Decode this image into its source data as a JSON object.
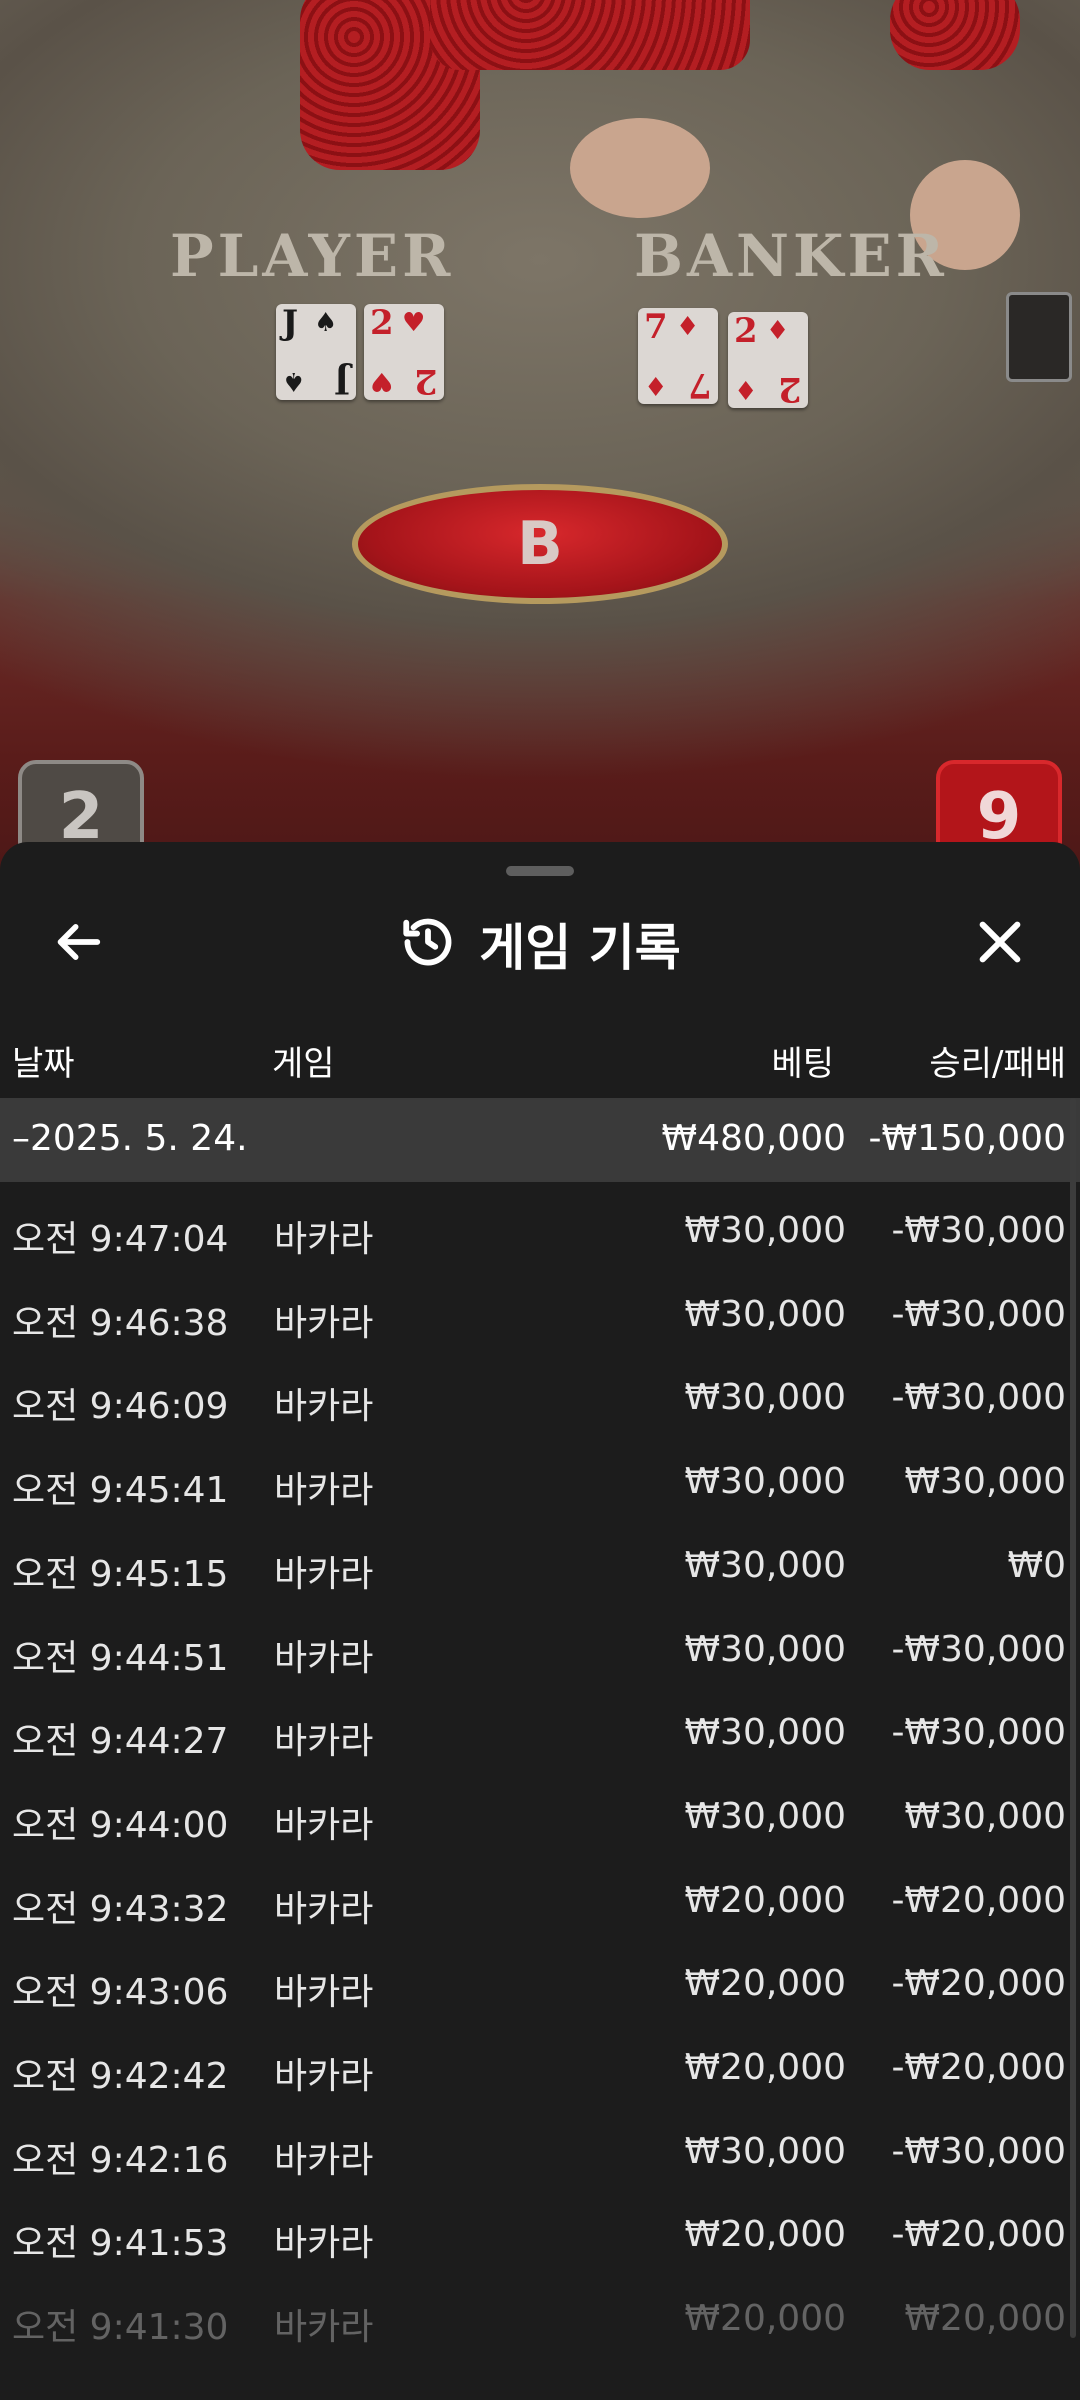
{
  "table": {
    "player_label": "PLAYER",
    "banker_label": "BANKER",
    "player_cards": [
      {
        "rank": "J",
        "suit": "♠",
        "color": "#1a1a1a"
      },
      {
        "rank": "2",
        "suit": "♥",
        "color": "#c4202a"
      }
    ],
    "banker_cards": [
      {
        "rank": "7",
        "suit": "♦",
        "color": "#c4202a"
      },
      {
        "rank": "2",
        "suit": "♦",
        "color": "#c4202a"
      }
    ],
    "result_letter": "B",
    "player_score": "2",
    "banker_score": "9"
  },
  "sheet": {
    "title": "게임 기록",
    "icons": {
      "back": "arrow-left-icon",
      "history": "history-icon",
      "close": "close-icon"
    },
    "columns": {
      "date": "날짜",
      "game": "게임",
      "bet": "베팅",
      "win_loss": "승리/패배"
    },
    "day_summary": {
      "date": "–2025. 5. 24.",
      "bet": "₩480,000",
      "win_loss": "-₩150,000"
    },
    "rows": [
      {
        "time": "오전 9:47:04",
        "game": "바카라",
        "bet": "₩30,000",
        "result": "-₩30,000"
      },
      {
        "time": "오전 9:46:38",
        "game": "바카라",
        "bet": "₩30,000",
        "result": "-₩30,000"
      },
      {
        "time": "오전 9:46:09",
        "game": "바카라",
        "bet": "₩30,000",
        "result": "-₩30,000"
      },
      {
        "time": "오전 9:45:41",
        "game": "바카라",
        "bet": "₩30,000",
        "result": "₩30,000"
      },
      {
        "time": "오전 9:45:15",
        "game": "바카라",
        "bet": "₩30,000",
        "result": "₩0"
      },
      {
        "time": "오전 9:44:51",
        "game": "바카라",
        "bet": "₩30,000",
        "result": "-₩30,000"
      },
      {
        "time": "오전 9:44:27",
        "game": "바카라",
        "bet": "₩30,000",
        "result": "-₩30,000"
      },
      {
        "time": "오전 9:44:00",
        "game": "바카라",
        "bet": "₩30,000",
        "result": "₩30,000"
      },
      {
        "time": "오전 9:43:32",
        "game": "바카라",
        "bet": "₩20,000",
        "result": "-₩20,000"
      },
      {
        "time": "오전 9:43:06",
        "game": "바카라",
        "bet": "₩20,000",
        "result": "-₩20,000"
      },
      {
        "time": "오전 9:42:42",
        "game": "바카라",
        "bet": "₩20,000",
        "result": "-₩20,000"
      },
      {
        "time": "오전 9:42:16",
        "game": "바카라",
        "bet": "₩30,000",
        "result": "-₩30,000"
      },
      {
        "time": "오전 9:41:53",
        "game": "바카라",
        "bet": "₩20,000",
        "result": "-₩20,000"
      },
      {
        "time": "오전 9:41:30",
        "game": "바카라",
        "bet": "₩20,000",
        "result": "₩20,000"
      }
    ]
  }
}
